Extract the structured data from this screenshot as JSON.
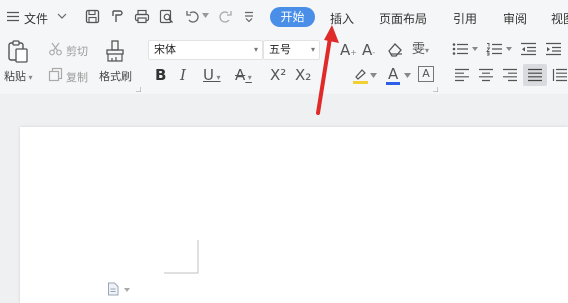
{
  "menu": {
    "hamburger_icon": "menu-icon",
    "file_label": "文件",
    "quick_icons": [
      "save-icon",
      "format-painter-icon",
      "print-icon",
      "print-preview-icon",
      "undo-icon",
      "redo-icon",
      "customize-icon"
    ],
    "tabs": [
      {
        "label": "开始",
        "active": true
      },
      {
        "label": "插入"
      },
      {
        "label": "页面布局"
      },
      {
        "label": "引用"
      },
      {
        "label": "审阅"
      },
      {
        "label": "视图"
      }
    ]
  },
  "ribbon": {
    "paste_label": "粘贴",
    "cut_label": "剪切",
    "copy_label": "复制",
    "format_painter_label": "格式刷",
    "font_name": "宋体",
    "font_size": "五号",
    "format_glyphs": {
      "bold": "B",
      "italic": "I",
      "underline": "U",
      "strikethrough": "A",
      "superscript": "X²",
      "subscript": "X₂",
      "grow_font": "A",
      "shrink_font": "A",
      "phonetic": "雯",
      "font_color": "A",
      "char_border": "A"
    }
  },
  "colors": {
    "accent": "#4a8fe7",
    "annotation_arrow": "#e02a2a",
    "font_color_bar": "#2d5fe8",
    "highlight_bar": "#f2d034",
    "ribbon_bg": "#f5f6f7",
    "document_bg": "#eff0f2"
  }
}
